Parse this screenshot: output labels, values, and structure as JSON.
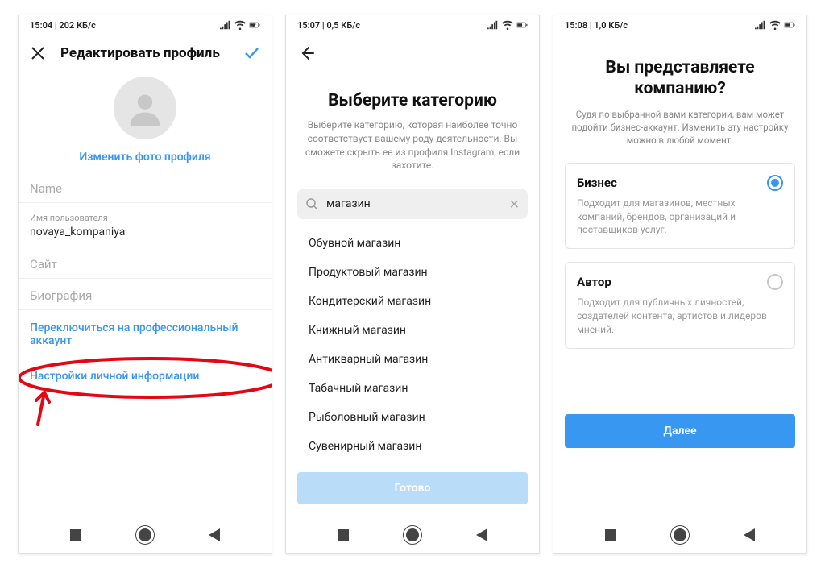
{
  "status": {
    "s1": "15:04 | 202 КБ/с",
    "s2": "15:07 | 0,5 КБ/с",
    "s3": "15:08 | 1,0 КБ/с",
    "battery": "57"
  },
  "screen1": {
    "title": "Редактировать профиль",
    "change_photo": "Изменить фото профиля",
    "fields": {
      "name_label": "Name",
      "username_label": "Имя пользователя",
      "username_value": "novaya_kompaniya",
      "site_label": "Сайт",
      "bio_label": "Биография"
    },
    "switch_link": "Переключиться на профессиональный аккаунт",
    "privacy_link": "Настройки личной информации"
  },
  "screen2": {
    "heading": "Выберите категорию",
    "sub": "Выберите категорию, которая наиболее точно соответствует вашему роду деятельности. Вы сможете скрыть ее из профиля Instagram, если захотите.",
    "search_value": "магазин",
    "categories": [
      "Обувной магазин",
      "Продуктовый магазин",
      "Кондитерский магазин",
      "Книжный магазин",
      "Антикварный магазин",
      "Табачный магазин",
      "Рыболовный магазин",
      "Сувенирный магазин"
    ],
    "done": "Готово"
  },
  "screen3": {
    "heading": "Вы представляете компанию?",
    "sub": "Судя по выбранной вами категории, вам может подойти бизнес-аккаунт. Изменить эту настройку можно в любой момент.",
    "option1": {
      "title": "Бизнес",
      "desc": "Подходит для магазинов, местных компаний, брендов, организаций и поставщиков услуг."
    },
    "option2": {
      "title": "Автор",
      "desc": "Подходит для публичных личностей, создателей контента, артистов и лидеров мнений."
    },
    "next": "Далее"
  }
}
